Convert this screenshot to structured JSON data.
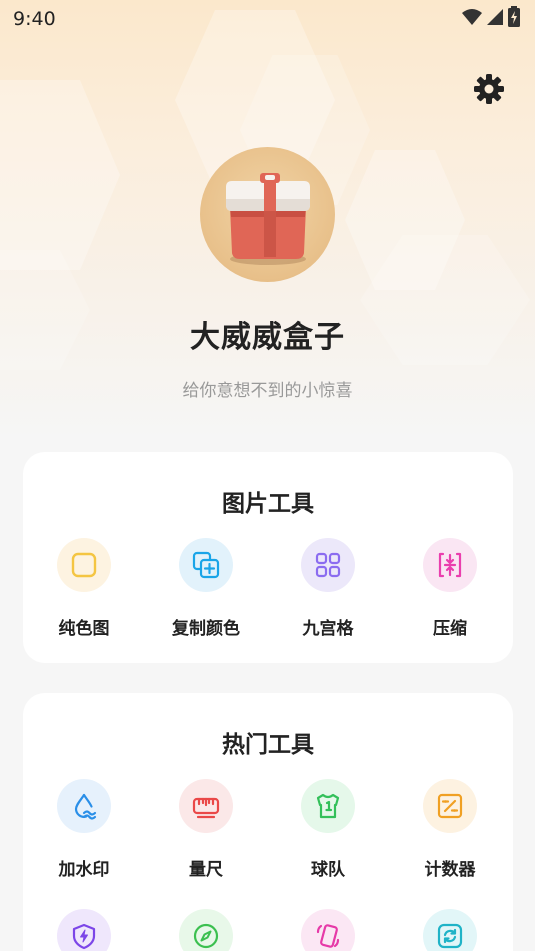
{
  "status_bar": {
    "time": "9:40",
    "icons": [
      "wifi-icon",
      "cell-signal-icon",
      "battery-charging-icon"
    ]
  },
  "header": {
    "settings_icon": "gear-icon",
    "app_title": "大威威盒子",
    "subtitle": "给你意想不到的小惊喜"
  },
  "image_tools": {
    "title": "图片工具",
    "items": [
      {
        "label": "纯色图",
        "icon": "square-icon",
        "color": "#f4c542",
        "bg": "#fdf3e1"
      },
      {
        "label": "复制颜色",
        "icon": "copy-add-icon",
        "color": "#1aa5e8",
        "bg": "#e2f2fb"
      },
      {
        "label": "九宫格",
        "icon": "grid-icon",
        "color": "#8b6cf0",
        "bg": "#ece8fa"
      },
      {
        "label": "压缩",
        "icon": "compress-icon",
        "color": "#ea3fae",
        "bg": "#fae6f3"
      }
    ]
  },
  "hot_tools": {
    "title": "热门工具",
    "items": [
      {
        "label": "加水印",
        "icon": "watermark-icon",
        "color": "#2a8fe8",
        "bg": "#e6f1fc"
      },
      {
        "label": "量尺",
        "icon": "ruler-icon",
        "color": "#ea4848",
        "bg": "#fbe8e8"
      },
      {
        "label": "球队",
        "icon": "jersey-icon",
        "color": "#33c05a",
        "bg": "#e5f8ea"
      },
      {
        "label": "计数器",
        "icon": "calculator-icon",
        "color": "#f0a023",
        "bg": "#fdf2e1"
      },
      {
        "label": "",
        "icon": "shield-bolt-icon",
        "color": "#7c46e8",
        "bg": "#efe7fc"
      },
      {
        "label": "",
        "icon": "compass-icon",
        "color": "#3cc050",
        "bg": "#e8f8e9"
      },
      {
        "label": "",
        "icon": "phone-rotate-icon",
        "color": "#e63aa8",
        "bg": "#fbe7f4"
      },
      {
        "label": "",
        "icon": "refresh-icon",
        "color": "#1fb3c7",
        "bg": "#e2f6f8"
      }
    ]
  }
}
